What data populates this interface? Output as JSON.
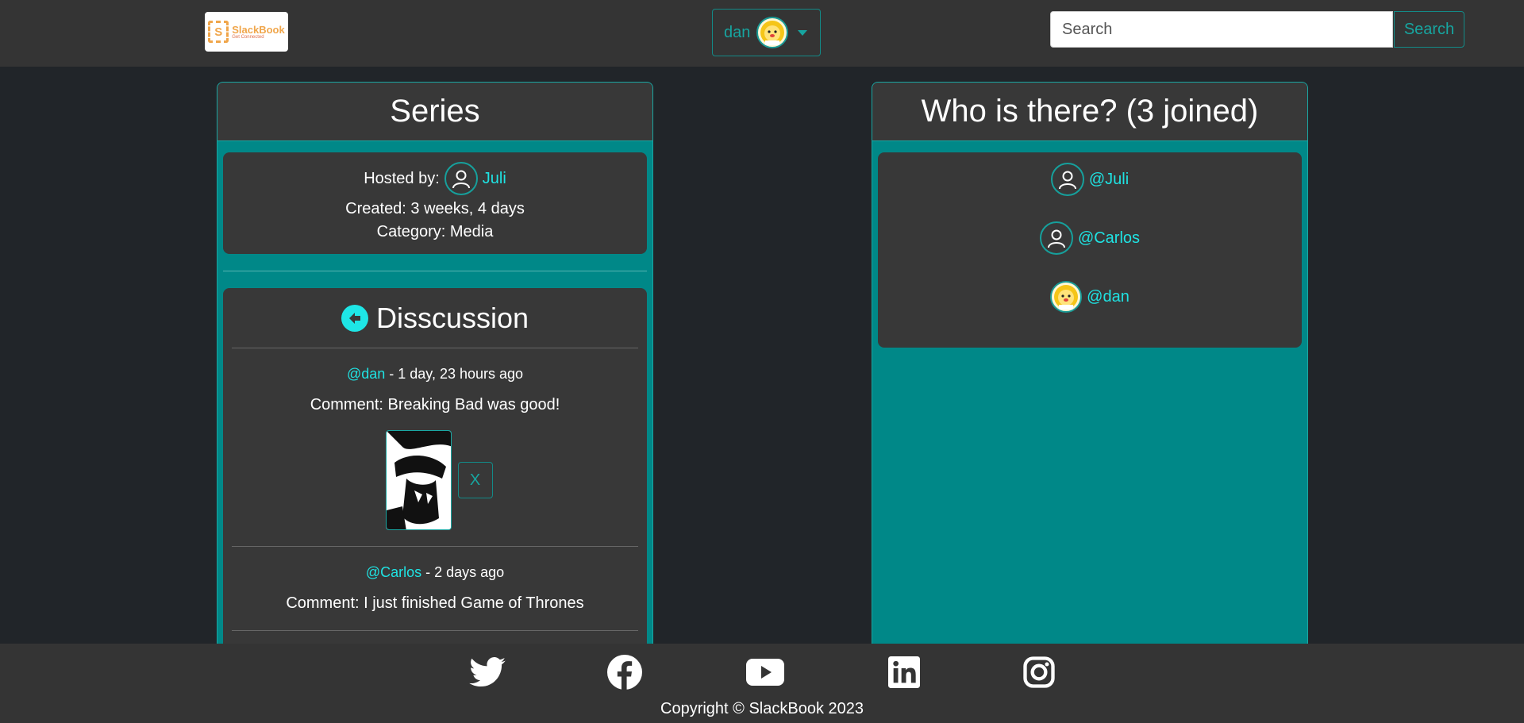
{
  "navbar": {
    "logo_name": "SlackBook",
    "logo_tagline": "Get Connected",
    "logo_mark": "S",
    "user_name": "dan",
    "search_placeholder": "Search",
    "search_button": "Search"
  },
  "group": {
    "title": "Series",
    "hosted_label": "Hosted by:",
    "host_name": "Juli",
    "created": "Created: 3 weeks, 4 days",
    "category": "Category: Media"
  },
  "discussion": {
    "title": "Disscussion",
    "comments": [
      {
        "author": "@dan",
        "time": " - 1 day, 23 hours ago",
        "text": "Comment: Breaking Bad was good!",
        "delete_label": "X"
      },
      {
        "author": "@Carlos",
        "time": " - 2 days ago",
        "text": "Comment: I just finished Game of Thrones"
      }
    ]
  },
  "members": {
    "title": "Who is there? (3 joined)",
    "list": [
      {
        "handle": "@Juli",
        "avatar": "user-icon"
      },
      {
        "handle": "@Carlos",
        "avatar": "user-icon"
      },
      {
        "handle": "@dan",
        "avatar": "lion-avatar"
      }
    ]
  },
  "footer": {
    "copyright": "Copyright © SlackBook 2023",
    "social": [
      "twitter-icon",
      "facebook-icon",
      "youtube-icon",
      "linkedin-icon",
      "instagram-icon"
    ]
  },
  "colors": {
    "accent": "#008888",
    "link": "#1fe3e3",
    "navbar": "#343434",
    "background": "#212529"
  }
}
